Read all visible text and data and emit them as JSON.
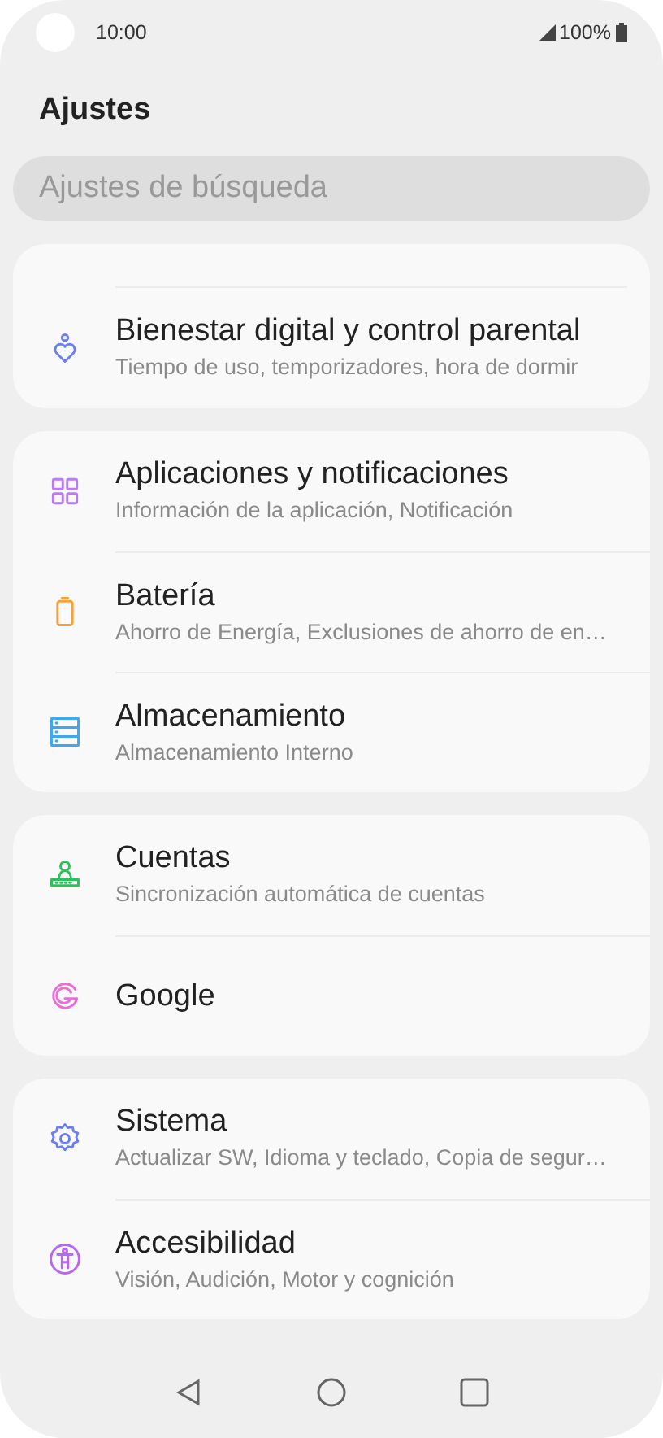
{
  "status_bar": {
    "time": "10:00",
    "battery": "100%"
  },
  "title": "Ajustes",
  "search": {
    "placeholder": "Ajustes de búsqueda"
  },
  "groups": [
    {
      "clipped_top": true,
      "items": [
        {
          "kind": "wellbeing",
          "color": "#6b7ff0",
          "title": "Bienestar digital y control parental",
          "subtitle": "Tiempo de uso, temporizadores, hora de dormir"
        }
      ]
    },
    {
      "clipped_top": false,
      "items": [
        {
          "kind": "apps",
          "color": "#b77cf5",
          "title": "Aplicaciones y notificaciones",
          "subtitle": "Información de la aplicación, Notificación"
        },
        {
          "kind": "battery",
          "color": "#f5a23c",
          "title": "Batería",
          "subtitle": "Ahorro de Energía, Exclusiones de ahorro de en…"
        },
        {
          "kind": "storage",
          "color": "#3aa8f5",
          "title": "Almacenamiento",
          "subtitle": "Almacenamiento Interno"
        }
      ]
    },
    {
      "clipped_top": false,
      "items": [
        {
          "kind": "accounts",
          "color": "#2cc25a",
          "title": "Cuentas",
          "subtitle": "Sincronización automática de cuentas"
        },
        {
          "kind": "google",
          "color": "#e86fd6",
          "title": "Google"
        }
      ]
    },
    {
      "clipped_top": false,
      "items": [
        {
          "kind": "system",
          "color": "#6b7ff0",
          "title": "Sistema",
          "subtitle": "Actualizar SW, Idioma y teclado, Copia de segur…"
        },
        {
          "kind": "accessibility",
          "color": "#b767f0",
          "title": "Accesibilidad",
          "subtitle": "Visión, Audición, Motor y cognición"
        }
      ]
    }
  ]
}
